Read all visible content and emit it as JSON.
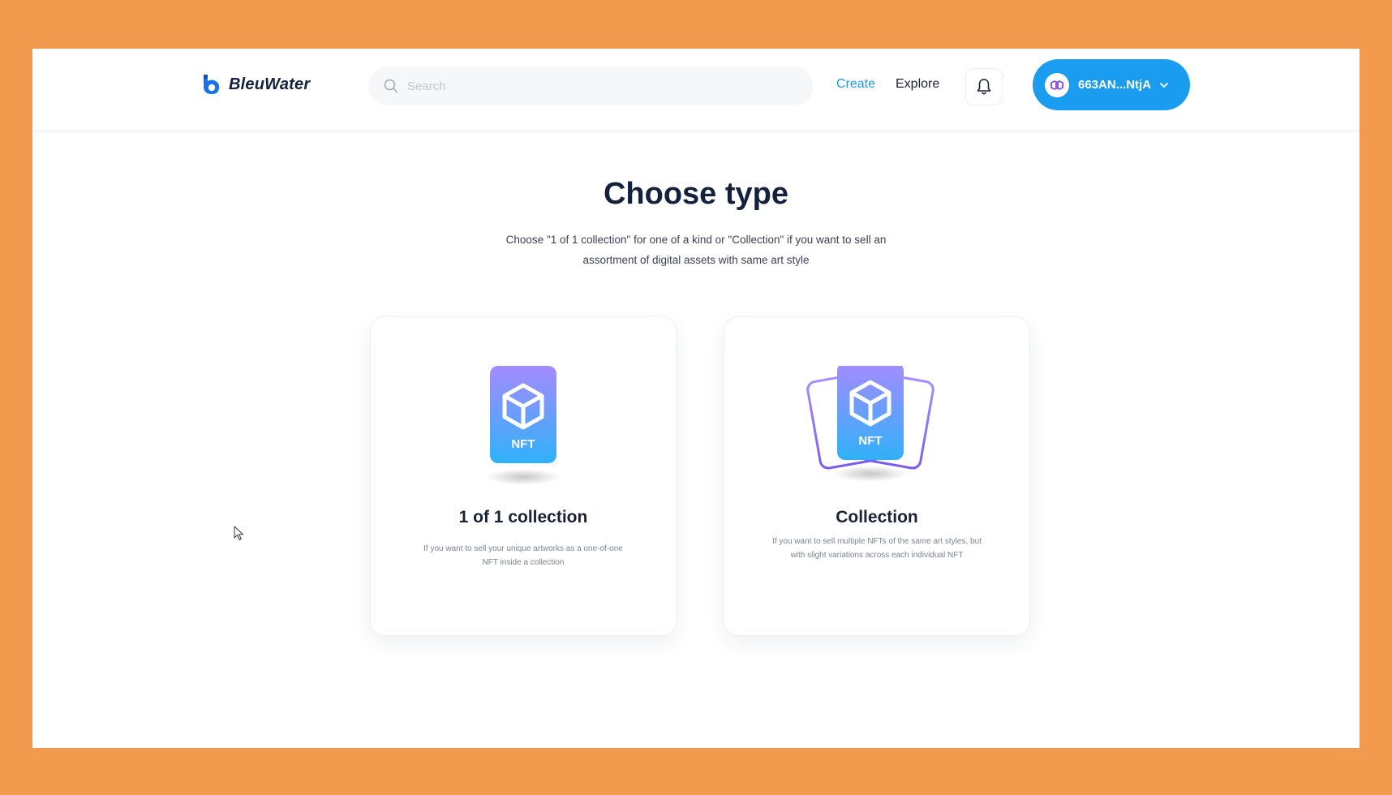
{
  "header": {
    "brand": "BleuWater",
    "search": {
      "placeholder": "Search",
      "value": ""
    },
    "nav": {
      "create": "Create",
      "explore": "Explore"
    },
    "wallet": {
      "address": "663AN...NtjA"
    }
  },
  "main": {
    "title": "Choose type",
    "subtitle": "Choose \"1 of 1 collection\" for one of a kind or \"Collection\" if you want to sell an assortment of digital assets with same art style",
    "cards": [
      {
        "badge": "NFT",
        "title": "1 of 1 collection",
        "description": "If you want to sell your unique artworks as a one-of-one NFT inside a collection"
      },
      {
        "badge": "NFT",
        "title": "Collection",
        "description": "If you want to sell multiple NFTs of the same art styles, but with slight variations across each individual NFT"
      }
    ]
  },
  "colors": {
    "accent": "#1a9cf0",
    "frame_background": "#F29B4E",
    "heading": "#14213d",
    "nft_gradient_top": "#a58bff",
    "nft_gradient_bottom": "#2fb1f8"
  },
  "icons": [
    "bleuwater-logo-icon",
    "search-icon",
    "bell-icon",
    "polygon-icon",
    "chevron-down-icon",
    "nft-cube-icon",
    "mouse-cursor-icon"
  ]
}
